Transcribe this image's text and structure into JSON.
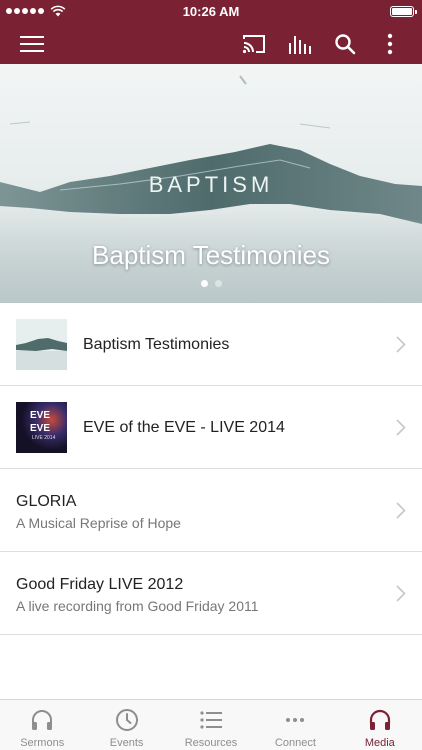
{
  "status_bar": {
    "time": "10:26 AM"
  },
  "colors": {
    "brand": "#7a2233",
    "inactive_tab": "#8e8e8e"
  },
  "nav": {
    "icons": [
      "menu-icon",
      "cast-icon",
      "audio-bars-icon",
      "search-icon",
      "more-vertical-icon"
    ]
  },
  "hero": {
    "artwork_word": "BAPTISM",
    "title": "Baptism Testimonies",
    "pages": 2,
    "active_page": 1
  },
  "list": {
    "items": [
      {
        "title": "Baptism Testimonies",
        "subtitle": "",
        "thumbnail": "baptism-artwork"
      },
      {
        "title": "EVE of the EVE - LIVE 2014",
        "subtitle": "",
        "thumbnail": "eve-artwork",
        "thumb_text": [
          "EVE",
          "EVE",
          "LIVE 2014"
        ]
      },
      {
        "title": "GLORIA",
        "subtitle": "A Musical Reprise of Hope",
        "thumbnail": ""
      },
      {
        "title": "Good Friday LIVE 2012",
        "subtitle": "A live recording from Good Friday 2011",
        "thumbnail": ""
      }
    ]
  },
  "tabs": [
    {
      "label": "Sermons",
      "icon": "headphones-icon",
      "active": false
    },
    {
      "label": "Events",
      "icon": "clock-icon",
      "active": false
    },
    {
      "label": "Resources",
      "icon": "list-icon",
      "active": false
    },
    {
      "label": "Connect",
      "icon": "ellipsis-icon",
      "active": false
    },
    {
      "label": "Media",
      "icon": "headphones-icon",
      "active": true
    }
  ]
}
